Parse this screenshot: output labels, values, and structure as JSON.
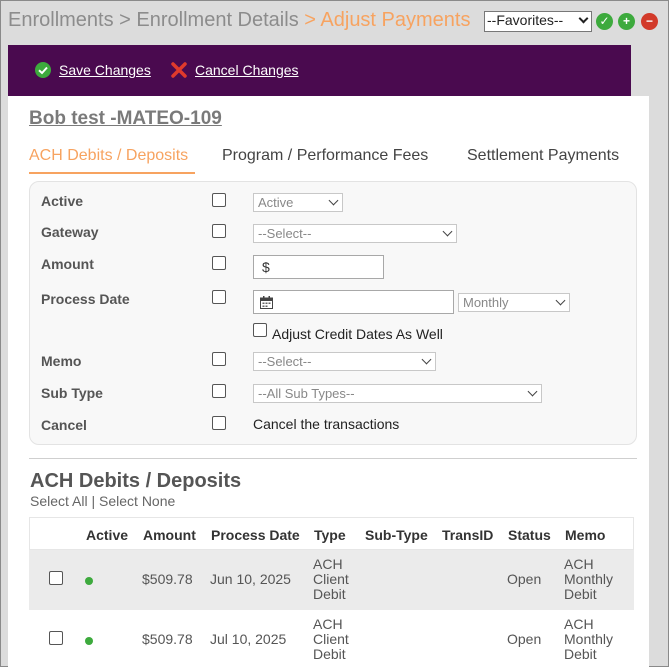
{
  "header": {
    "crumb_1": "Enrollments",
    "crumb_sep_1": " > ",
    "crumb_2": "Enrollment Details",
    "crumb_sep_2": " > ",
    "crumb_current": "Adjust Payments",
    "favorites_selected": "--Favorites--"
  },
  "actions": {
    "save_label": "Save Changes",
    "cancel_label": "Cancel Changes"
  },
  "client": {
    "name": "Bob test -MATEO-109"
  },
  "tabs": [
    {
      "label": "ACH Debits / Deposits"
    },
    {
      "label": "Program / Performance Fees"
    },
    {
      "label": "Settlement Payments"
    }
  ],
  "form": {
    "active_label": "Active",
    "active_select": "Active",
    "gateway_label": "Gateway",
    "gateway_select": "--Select--",
    "amount_label": "Amount",
    "amount_prefix": "$",
    "process_date_label": "Process Date",
    "frequency_select": "Monthly",
    "adjust_credit_label": "Adjust Credit Dates As Well",
    "memo_label": "Memo",
    "memo_select": "--Select--",
    "subtype_label": "Sub Type",
    "subtype_select": "--All Sub Types--",
    "cancel_label": "Cancel",
    "cancel_text": "Cancel the transactions"
  },
  "list": {
    "title": "ACH Debits / Deposits",
    "select_all": "Select All",
    "sep": " | ",
    "select_none": "Select None",
    "columns": [
      "Active",
      "Amount",
      "Process Date",
      "Type",
      "Sub-Type",
      "TransID",
      "Status",
      "Memo"
    ],
    "rows": [
      {
        "amount": "$509.78",
        "process_date": "Jun 10, 2025",
        "type_1": "ACH",
        "type_2": "Client",
        "type_3": "Debit",
        "status": "Open",
        "memo_1": "ACH",
        "memo_2": "Monthly",
        "memo_3": "Debit"
      },
      {
        "amount": "$509.78",
        "process_date": "Jul 10, 2025",
        "type_1": "ACH",
        "type_2": "Client",
        "type_3": "Debit",
        "status": "Open",
        "memo_1": "ACH",
        "memo_2": "Monthly",
        "memo_3": "Debit"
      }
    ]
  },
  "colors": {
    "accent_orange": "#f7a360",
    "action_bar_purple": "#4a0a4f",
    "ok_green": "#3daa3d",
    "remove_red": "#d23a2a"
  }
}
